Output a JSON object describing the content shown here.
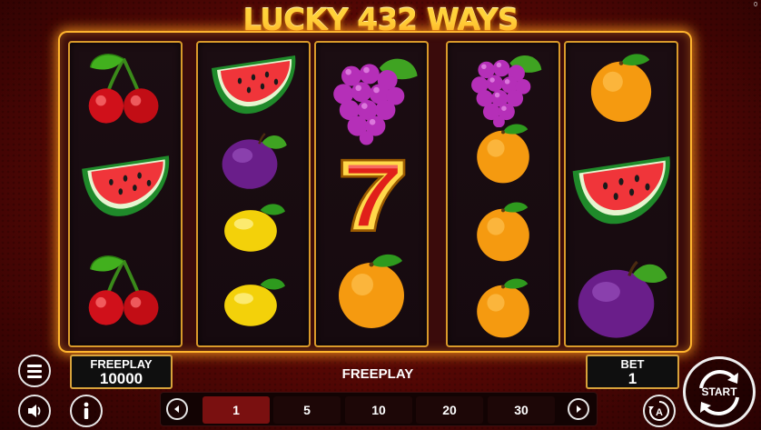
{
  "game": {
    "title": "LUCKY 432 WAYS",
    "corner_counter": "0"
  },
  "reels": [
    [
      "cherry",
      "watermelon",
      "cherry"
    ],
    [
      "watermelon",
      "plum",
      "lemon",
      "lemon"
    ],
    [
      "grapes",
      "seven",
      "orange"
    ],
    [
      "grapes",
      "orange",
      "orange",
      "orange"
    ],
    [
      "orange",
      "watermelon",
      "plum"
    ]
  ],
  "panels": {
    "freeplay_label": "FREEPLAY",
    "freeplay_value": "10000",
    "mode_text": "FREEPLAY",
    "bet_label": "BET",
    "bet_value": "1"
  },
  "bet_options": [
    "1",
    "5",
    "10",
    "20",
    "30"
  ],
  "selected_bet": "1",
  "buttons": {
    "start_label": "START",
    "autoplay_label": "A"
  },
  "icons": {
    "menu": "menu-icon",
    "sound": "speaker-icon",
    "info": "info-icon",
    "prev": "arrow-left-icon",
    "next": "arrow-right-icon",
    "autoplay": "autoplay-icon",
    "start": "spin-icon"
  }
}
